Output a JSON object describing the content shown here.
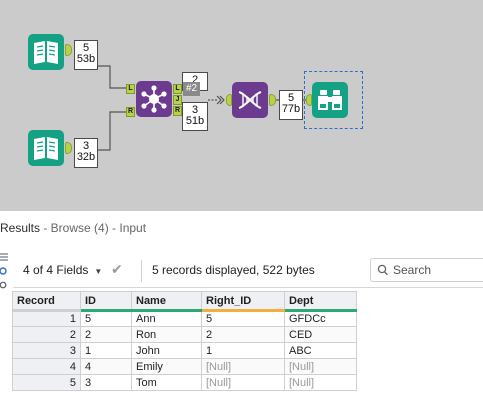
{
  "canvas": {
    "input1": {
      "records": "5",
      "bytes": "53b"
    },
    "input2": {
      "records": "3",
      "bytes": "32b"
    },
    "join": {
      "anchor_in_left": "L",
      "anchor_in_right": "R",
      "anchor_out_left": "L",
      "anchor_out_join": "J",
      "anchor_out_right": "R",
      "out_top": {
        "records": "2",
        "bytes": ""
      },
      "out_bottom": {
        "records": "3",
        "bytes": "51b"
      },
      "container_tag": "#2"
    },
    "formula": {
      "records": "5",
      "bytes": "77b"
    },
    "icons": {
      "input": "book-icon",
      "join": "join-icon",
      "formula": "dna-icon",
      "browse": "binoculars-icon"
    },
    "colors": {
      "canvas_bg": "#cbcbcb",
      "input_green": "#15a184",
      "join_purple": "#6c3a8e",
      "anchor_green": "#b6d24a",
      "selection": "#2d6fd0"
    }
  },
  "results": {
    "title": "Results",
    "subtitle": " - Browse (4) - Input",
    "fields_selector": "4 of 4 Fields",
    "records_info": "5 records displayed, 522 bytes",
    "search_placeholder": "Search",
    "icons": [
      "list-icon",
      "link-icon",
      "gear-icon"
    ]
  },
  "table": {
    "columns": [
      "Record",
      "ID",
      "Name",
      "Right_ID",
      "Dept"
    ],
    "rows": [
      [
        "1",
        "5",
        "Ann",
        "5",
        "GFDCc"
      ],
      [
        "2",
        "2",
        "Ron",
        "2",
        "CED"
      ],
      [
        "3",
        "1",
        "John",
        "1",
        "ABC"
      ],
      [
        "4",
        "4",
        "Emily",
        "[Null]",
        "[Null]"
      ],
      [
        "5",
        "3",
        "Tom",
        "[Null]",
        "[Null]"
      ]
    ]
  }
}
